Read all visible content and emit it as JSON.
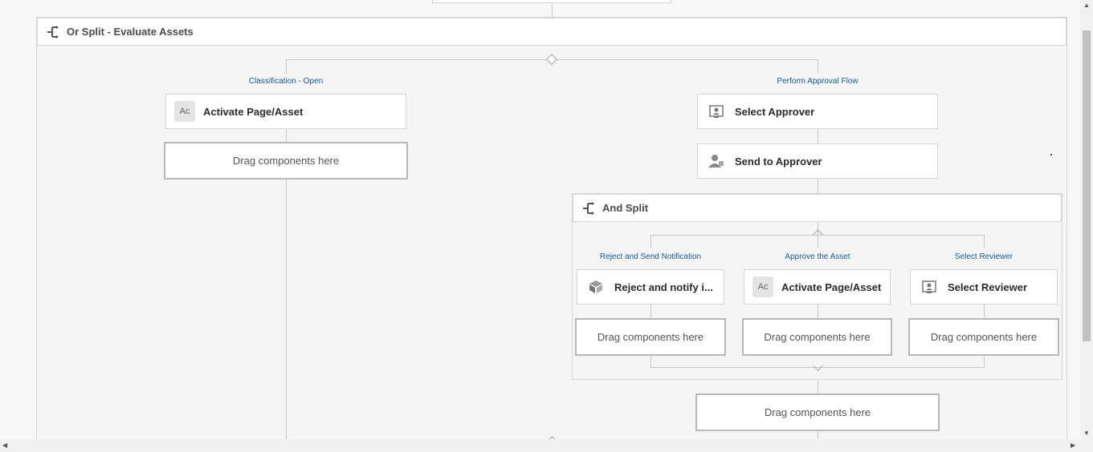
{
  "or_split": {
    "title": "Or Split - Evaluate Assets",
    "branches": [
      {
        "label": "Classification - Open"
      },
      {
        "label": "Perform Approval Flow"
      }
    ]
  },
  "steps": {
    "activate_left": "Activate Page/Asset",
    "select_approver": "Select Approver",
    "send_to_approver": "Send to Approver",
    "reject_notify": "Reject and notify i...",
    "activate_inner": "Activate Page/Asset",
    "select_reviewer": "Select Reviewer"
  },
  "and_split": {
    "title": "And Split",
    "branches": [
      {
        "label": "Reject and Send Notification"
      },
      {
        "label": "Approve the Asset"
      },
      {
        "label": "Select Reviewer"
      }
    ]
  },
  "drop_zone_label": "Drag components here",
  "icons": {
    "ac_text": "Ac",
    "split": "split-icon",
    "approver": "user-select-icon",
    "person": "person-icon",
    "box": "package-icon"
  }
}
